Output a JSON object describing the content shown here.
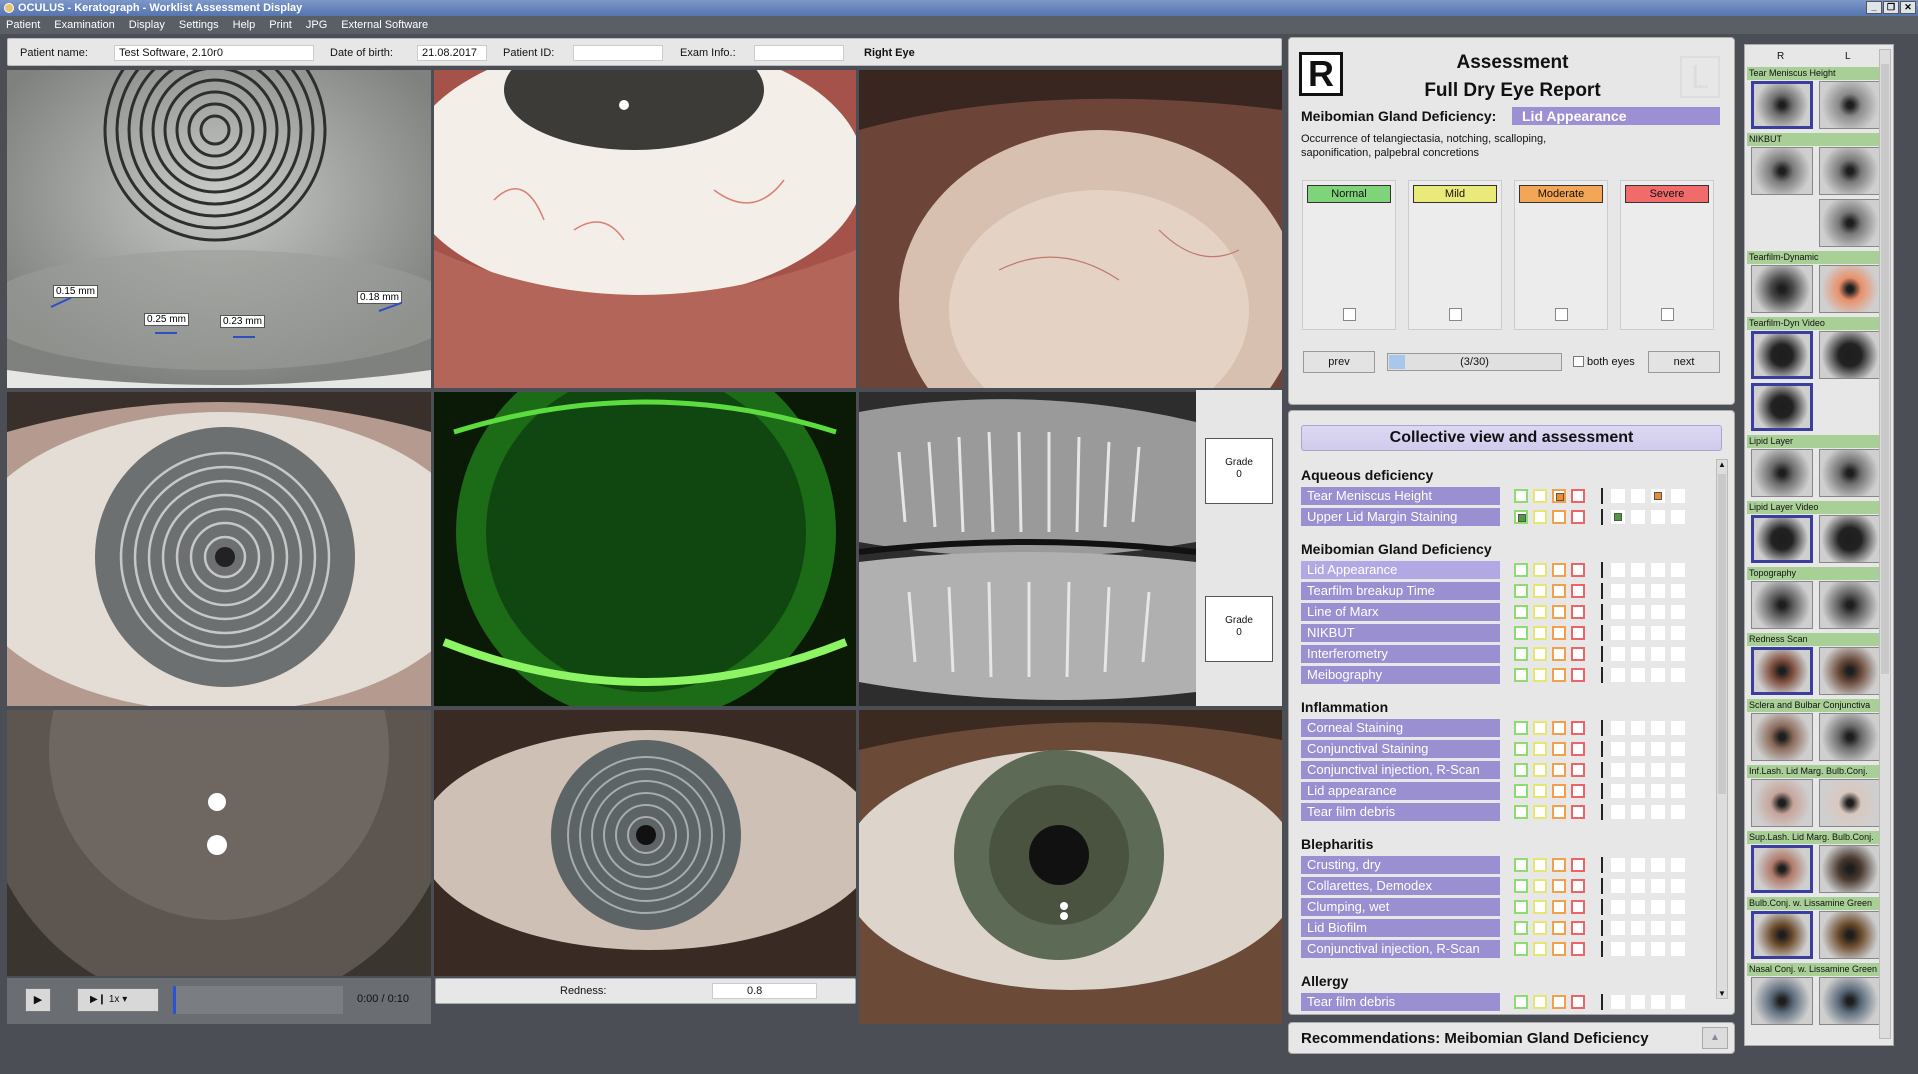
{
  "window": {
    "title": "OCULUS - Keratograph - Worklist Assessment Display",
    "buttons": [
      "_",
      "❐",
      "✕"
    ]
  },
  "menu": [
    "Patient",
    "Examination",
    "Display",
    "Settings",
    "Help",
    "Print",
    "JPG",
    "External Software"
  ],
  "patient": {
    "name_label": "Patient name:",
    "name": "Test Software, 2.10r0",
    "dob_label": "Date of birth:",
    "dob": "21.08.2017",
    "id_label": "Patient ID:",
    "id": "",
    "exam_label": "Exam Info.:",
    "exam": "",
    "eye": "Right Eye"
  },
  "measurements": [
    "0.15 mm",
    "0.25 mm",
    "0.23 mm",
    "0.18 mm"
  ],
  "grades": [
    {
      "label": "Grade",
      "value": "0"
    },
    {
      "label": "Grade",
      "value": "0"
    }
  ],
  "video": {
    "play": "▶",
    "speed": "1x",
    "time": "0:00 / 0:10"
  },
  "redness": {
    "label": "Redness:",
    "value": "0.8"
  },
  "assessment": {
    "left_badge": "R",
    "right_badge": "L",
    "title": "Assessment",
    "subtitle": "Full Dry Eye Report",
    "category_label": "Meibomian Gland Deficiency:",
    "category_value": "Lid Appearance",
    "description": "Occurrence of telangiectasia, notching, scalloping, saponification, palpebral concretions",
    "severities": [
      {
        "label": "Normal",
        "color": "#7fd47a"
      },
      {
        "label": "Mild",
        "color": "#eaea7a"
      },
      {
        "label": "Moderate",
        "color": "#f3a655"
      },
      {
        "label": "Severe",
        "color": "#f26b6b"
      }
    ],
    "prev": "prev",
    "next": "next",
    "progress": "(3/30)",
    "both_eyes": "both eyes"
  },
  "collective": {
    "title": "Collective view and assessment",
    "sections": [
      {
        "name": "Aqueous deficiency",
        "rows": [
          {
            "label": "Tear Meniscus Height",
            "r": 2,
            "l": 2
          },
          {
            "label": "Upper Lid Margin Staining",
            "r": 0,
            "l": 0
          }
        ]
      },
      {
        "name": "Meibomian Gland Deficiency",
        "rows": [
          {
            "label": "Lid Appearance",
            "sel": true
          },
          {
            "label": "Tearfilm breakup Time"
          },
          {
            "label": "Line of Marx"
          },
          {
            "label": "NIKBUT"
          },
          {
            "label": "Interferometry"
          },
          {
            "label": "Meibography"
          }
        ]
      },
      {
        "name": "Inflammation",
        "rows": [
          {
            "label": "Corneal Staining"
          },
          {
            "label": "Conjunctival Staining"
          },
          {
            "label": "Conjunctival injection, R-Scan"
          },
          {
            "label": "Lid appearance"
          },
          {
            "label": "Tear film debris"
          }
        ]
      },
      {
        "name": "Blepharitis",
        "rows": [
          {
            "label": "Crusting, dry"
          },
          {
            "label": "Collarettes, Demodex"
          },
          {
            "label": "Clumping, wet"
          },
          {
            "label": "Lid Biofilm"
          },
          {
            "label": "Conjunctival injection, R-Scan"
          }
        ]
      },
      {
        "name": "Allergy",
        "rows": [
          {
            "label": "Tear film debris"
          }
        ]
      }
    ]
  },
  "recommendations": "Recommendations: Meibomian Gland Deficiency",
  "thumbs": {
    "col_r": "R",
    "col_l": "L",
    "groups": [
      {
        "label": "Tear Meniscus Height"
      },
      {
        "label": "NIKBUT"
      },
      {
        "label": "Tearfilm-Dynamic"
      },
      {
        "label": "Tearfilm-Dyn Video"
      },
      {
        "label": "Lipid Layer"
      },
      {
        "label": "Lipid Layer Video"
      },
      {
        "label": "Topography"
      },
      {
        "label": "Redness Scan"
      },
      {
        "label": "Sclera and Bulbar Conjunctiva"
      },
      {
        "label": "Inf.Lash. Lid Marg. Bulb.Conj."
      },
      {
        "label": "Sup.Lash. Lid Marg. Bulb.Conj."
      },
      {
        "label": "Bulb.Conj. w. Lissamine Green"
      },
      {
        "label": "Nasal Conj. w. Lissamine Green"
      }
    ]
  }
}
